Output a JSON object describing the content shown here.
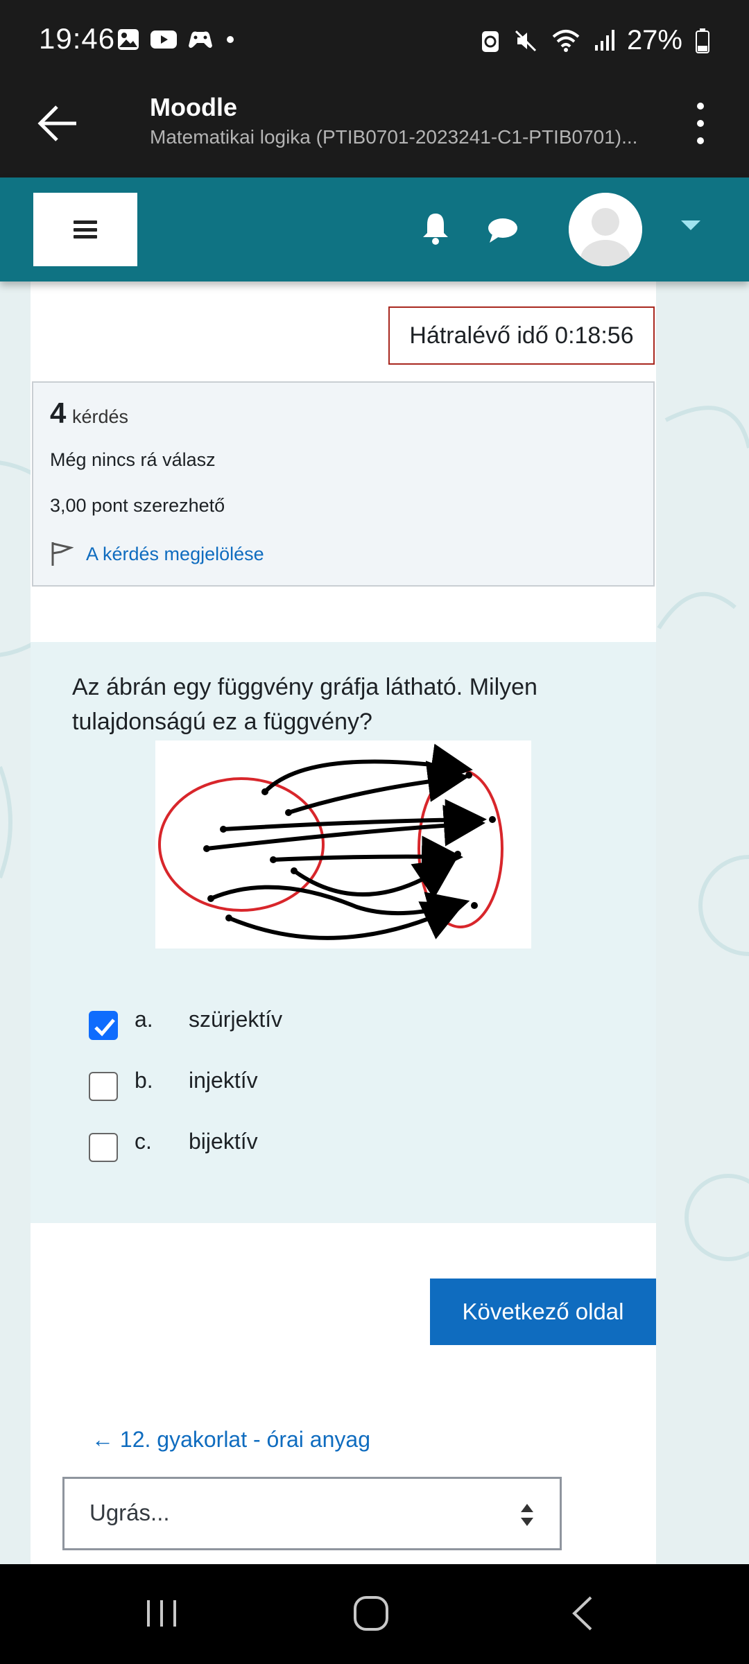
{
  "status_bar": {
    "time": "19:46",
    "battery": "27%"
  },
  "app_bar": {
    "title": "Moodle",
    "subtitle": "Matematikai logika (PTIB0701-2023241-C1-PTIB0701)..."
  },
  "quiz": {
    "timer": "Hátralévő idő 0:18:56",
    "question_number": "4",
    "question_number_label": "kérdés",
    "state": "Még nincs rá válasz",
    "grade": "3,00 pont szerezhető",
    "flag_label": "A kérdés megjelölése",
    "question_text": "Az ábrán egy függvény gráfja látható. Milyen tulajdonságú ez a függvény?",
    "answers": [
      {
        "letter": "a.",
        "text": "szürjektív",
        "checked": true
      },
      {
        "letter": "b.",
        "text": "injektív",
        "checked": false
      },
      {
        "letter": "c.",
        "text": "bijektív",
        "checked": false
      }
    ],
    "next_button": "Következő oldal"
  },
  "navigation": {
    "prev_link": "← 12. gyakorlat - órai  anyag",
    "jump_placeholder": "Ugrás..."
  },
  "colors": {
    "navbar": "#0f7383",
    "primary": "#0f6cbf",
    "timer_border": "#a8281f",
    "diagram_ellipse": "#d8262b"
  },
  "icons": {
    "back": "arrow-left-icon",
    "menu": "hamburger-icon",
    "notifications": "bell-icon",
    "messages": "chat-icon",
    "flag": "flag-icon"
  }
}
